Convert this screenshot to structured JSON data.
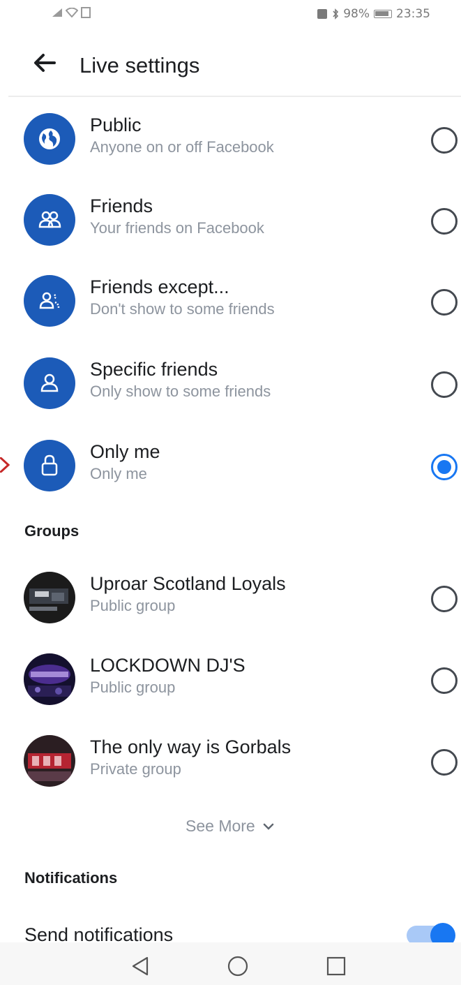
{
  "status_bar": {
    "left_icons": "signal-wifi-sim",
    "right_text": "98%",
    "time": "23:35"
  },
  "header": {
    "title": "Live settings"
  },
  "audience_options": [
    {
      "title": "Public",
      "subtitle": "Anyone on or off Facebook",
      "icon": "globe-icon",
      "selected": false
    },
    {
      "title": "Friends",
      "subtitle": "Your friends on Facebook",
      "icon": "friends-icon",
      "selected": false
    },
    {
      "title": "Friends except...",
      "subtitle": "Don't show to some friends",
      "icon": "friends-except-icon",
      "selected": false
    },
    {
      "title": "Specific friends",
      "subtitle": "Only show to some friends",
      "icon": "person-icon",
      "selected": false
    },
    {
      "title": "Only me",
      "subtitle": "Only me",
      "icon": "lock-icon",
      "selected": true
    }
  ],
  "groups": {
    "heading": "Groups",
    "items": [
      {
        "title": "Uproar Scotland Loyals",
        "subtitle": "Public group",
        "selected": false
      },
      {
        "title": "LOCKDOWN DJ'S",
        "subtitle": "Public group",
        "selected": false
      },
      {
        "title": "The only way is Gorbals",
        "subtitle": "Private group",
        "selected": false
      }
    ],
    "see_more": "See More"
  },
  "notifications": {
    "heading": "Notifications",
    "send_label": "Send notifications",
    "send_enabled": true
  },
  "colors": {
    "accent": "#1877f2",
    "icon_circle": "#1c5bb8",
    "secondary_text": "#8d949e"
  }
}
